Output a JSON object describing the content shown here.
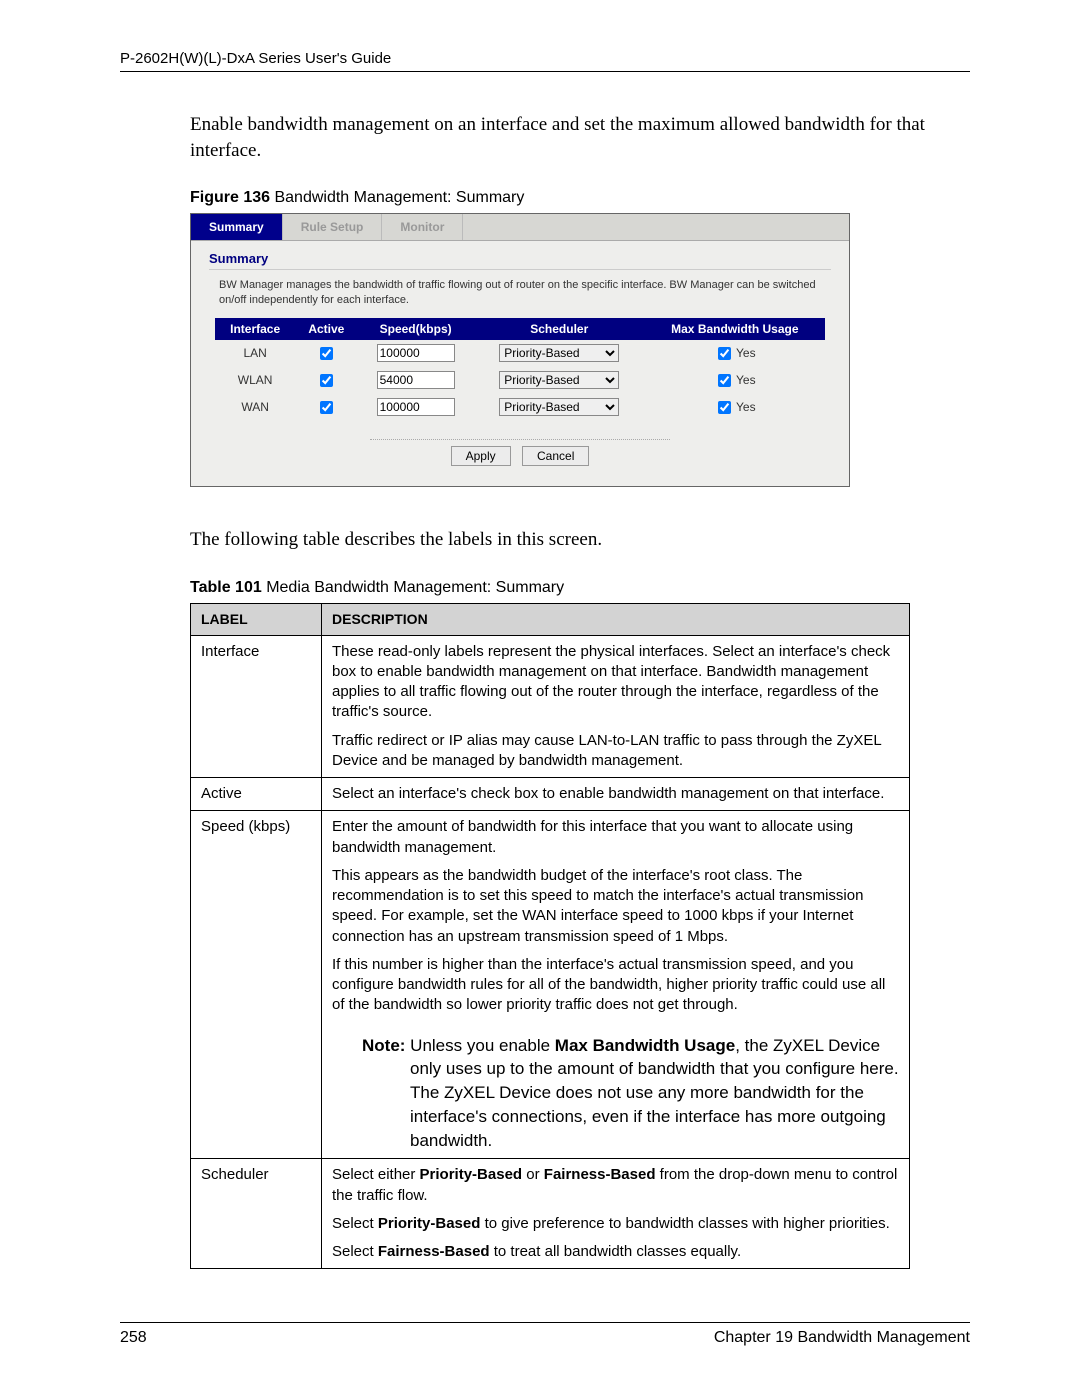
{
  "header": {
    "guide_title": "P-2602H(W)(L)-DxA Series User's Guide"
  },
  "intro": "Enable bandwidth management on an interface and set the maximum allowed bandwidth for that interface.",
  "figure_caption": {
    "lead": "Figure 136",
    "rest": "   Bandwidth Management: Summary"
  },
  "ui": {
    "tabs": {
      "summary": "Summary",
      "rule_setup": "Rule Setup",
      "monitor": "Monitor"
    },
    "panel_title": "Summary",
    "panel_desc": "BW Manager manages the bandwidth of traffic flowing out of router on the specific interface. BW Manager can be switched on/off independently for each interface.",
    "headers": {
      "interface": "Interface",
      "active": "Active",
      "speed": "Speed(kbps)",
      "scheduler": "Scheduler",
      "max": "Max Bandwidth Usage"
    },
    "rows": [
      {
        "iface": "LAN",
        "active": true,
        "speed": "100000",
        "scheduler": "Priority-Based",
        "max": true,
        "yes": "Yes"
      },
      {
        "iface": "WLAN",
        "active": true,
        "speed": "54000",
        "scheduler": "Priority-Based",
        "max": true,
        "yes": "Yes"
      },
      {
        "iface": "WAN",
        "active": true,
        "speed": "100000",
        "scheduler": "Priority-Based",
        "max": true,
        "yes": "Yes"
      }
    ],
    "buttons": {
      "apply": "Apply",
      "cancel": "Cancel"
    }
  },
  "post_figure": "The following table describes the labels in this screen.",
  "table_caption": {
    "lead": "Table 101",
    "rest": "   Media Bandwidth Management: Summary"
  },
  "desc_headers": {
    "label": "LABEL",
    "description": "DESCRIPTION"
  },
  "desc_rows": {
    "interface": {
      "label": "Interface",
      "p1": "These read-only labels represent the physical interfaces. Select an interface's check box to enable bandwidth management on that interface. Bandwidth management applies to all traffic flowing out of the router through the interface, regardless of the traffic's source.",
      "p2": "Traffic redirect or IP alias may cause LAN-to-LAN traffic to pass through the ZyXEL Device and be managed by bandwidth management."
    },
    "active": {
      "label": "Active",
      "p1": "Select an interface's check box to enable bandwidth management on that interface."
    },
    "speed": {
      "label": "Speed (kbps)",
      "p1": "Enter the amount of bandwidth for this interface that you want to allocate using bandwidth management.",
      "p2": "This appears as the bandwidth budget of the interface's root class. The recommendation is to set this speed to match the interface's actual transmission speed. For example, set the WAN interface speed to 1000 kbps if your Internet connection has an upstream transmission speed of 1 Mbps.",
      "p3": "If this number is higher than the interface's actual transmission speed, and you configure bandwidth rules for all of the bandwidth, higher priority traffic could use all of the bandwidth so lower priority traffic does not get through.",
      "note_lead": "Note:",
      "note_mid1": " Unless you enable ",
      "note_bold": "Max Bandwidth Usage",
      "note_mid2": ", the ZyXEL Device ",
      "note_rest": "only uses up to the amount of bandwidth that you configure here. The ZyXEL Device does not use any more bandwidth for the interface's connections, even if the interface has more outgoing bandwidth."
    },
    "scheduler": {
      "label": "Scheduler",
      "p1a": "Select either ",
      "p1b": "Priority-Based",
      "p1c": " or ",
      "p1d": "Fairness-Based",
      "p1e": " from the drop-down menu to control the traffic flow.",
      "p2a": "Select ",
      "p2b": "Priority-Based",
      "p2c": " to give preference to bandwidth classes with higher priorities.",
      "p3a": "Select ",
      "p3b": "Fairness-Based",
      "p3c": " to treat all bandwidth classes equally."
    }
  },
  "footer": {
    "page": "258",
    "chapter": "Chapter 19 Bandwidth Management"
  }
}
